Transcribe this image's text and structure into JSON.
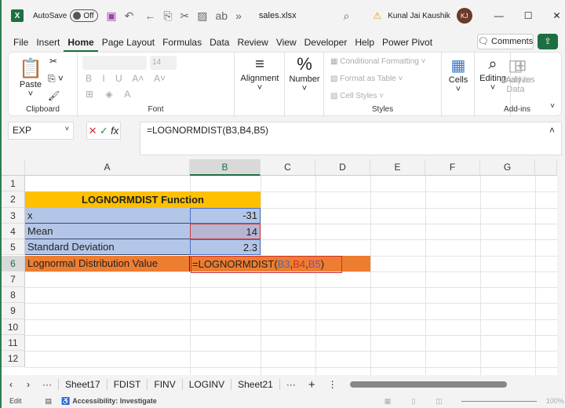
{
  "title": {
    "autosave": "AutoSave",
    "toggle": "Off",
    "filename": "sales.xlsx",
    "user": "Kunal Jai Kaushik",
    "initials": "KJ"
  },
  "tabs": [
    "File",
    "Insert",
    "Home",
    "Page Layout",
    "Formulas",
    "Data",
    "Review",
    "View",
    "Developer",
    "Help",
    "Power Pivot"
  ],
  "comments": "Comments",
  "ribbon": {
    "paste": "Paste",
    "clipboard": "Clipboard",
    "font_size": "14",
    "font": "Font",
    "alignment": "Alignment",
    "number": "Number",
    "cond_format": "Conditional Formatting",
    "format_table": "Format as Table",
    "cell_styles": "Cell Styles",
    "styles": "Styles",
    "cells": "Cells",
    "editing": "Editing",
    "addins": "Add-ins",
    "analyze": "Analyze Data",
    "addins_group": "Add-ins"
  },
  "formula_bar": {
    "name_box": "EXP",
    "formula": "=LOGNORMDIST(B3,B4,B5)"
  },
  "columns": [
    "A",
    "B",
    "C",
    "D",
    "E",
    "F",
    "G"
  ],
  "rows": [
    "1",
    "2",
    "3",
    "4",
    "5",
    "6",
    "7",
    "8",
    "9",
    "10",
    "11",
    "12"
  ],
  "cells": {
    "title": "LOGNORMDIST Function",
    "a3": "x",
    "b3": "-31",
    "a4": "Mean",
    "b4": "14",
    "a5": "Standard Deviation",
    "b5": "2.3",
    "a6": "Lognormal Distribution Value",
    "b6_fn": "=LOGNORMDIST(",
    "b6_r1": "B3",
    "b6_r2": "B4",
    "b6_r3": "B5",
    "b6_end": ")",
    "comma": ","
  },
  "sheets": [
    "Sheet17",
    "FDIST",
    "FINV",
    "LOGINV",
    "Sheet21"
  ],
  "status": {
    "mode": "Edit",
    "accessibility": "Accessibility: Investigate",
    "zoom": "100%"
  },
  "colors": {
    "accent": "#1d6f42",
    "title_fill": "#ffc000",
    "blue_fill": "#b4c6e7",
    "orange_fill": "#ed7d31"
  }
}
